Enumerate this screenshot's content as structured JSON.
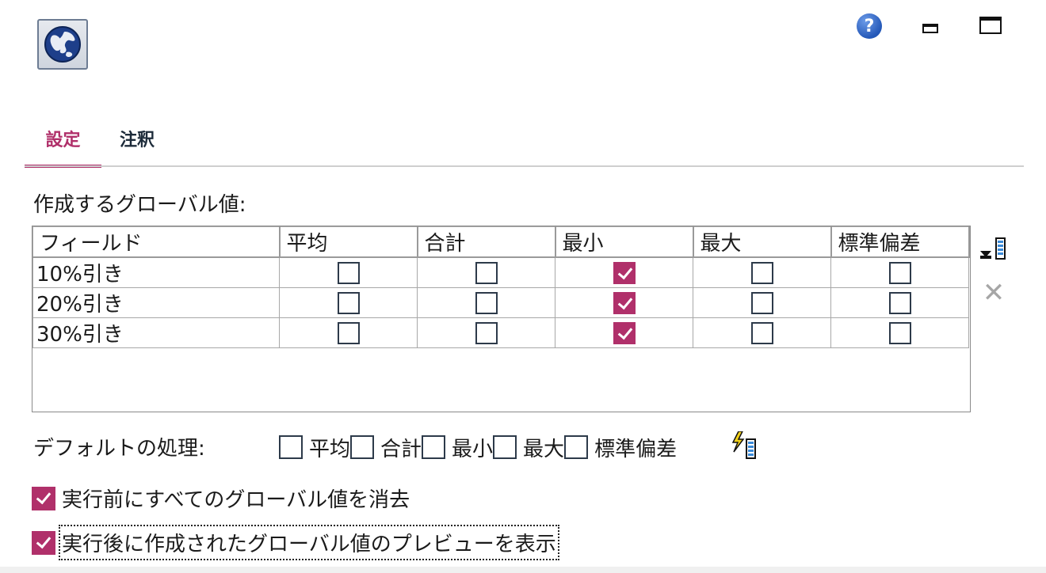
{
  "window": {
    "help_icon": "question-circle",
    "minimize_icon": "window-minimize",
    "maximize_icon": "window-maximize",
    "node_icon": "globe"
  },
  "tabs": [
    {
      "label": "設定",
      "active": true
    },
    {
      "label": "注釈",
      "active": false
    }
  ],
  "globals_label": "作成するグローバル値:",
  "table": {
    "columns": [
      "フィールド",
      "平均",
      "合計",
      "最小",
      "最大",
      "標準偏差"
    ],
    "rows": [
      {
        "field": "10%引き",
        "mean": false,
        "sum": false,
        "min": true,
        "max": false,
        "sdev": false
      },
      {
        "field": "20%引き",
        "mean": false,
        "sum": false,
        "min": true,
        "max": false,
        "sdev": false
      },
      {
        "field": "30%引き",
        "mean": false,
        "sum": false,
        "min": true,
        "max": false,
        "sdev": false
      }
    ]
  },
  "side_buttons": {
    "add_icon": "field-picker",
    "delete_icon": "delete-x"
  },
  "default_label": "デフォルトの処理:",
  "default_options": [
    {
      "label": "平均",
      "checked": false
    },
    {
      "label": "合計",
      "checked": false
    },
    {
      "label": "最小",
      "checked": false
    },
    {
      "label": "最大",
      "checked": false
    },
    {
      "label": "標準偏差",
      "checked": false
    }
  ],
  "default_apply_icon": "apply-defaults",
  "options": [
    {
      "label": "実行前にすべてのグローバル値を消去",
      "checked": true
    },
    {
      "label": "実行後に作成されたグローバル値のプレビューを表示",
      "checked": true
    }
  ],
  "colors": {
    "accent": "#b0306a",
    "tab_inactive": "#1d2b3a",
    "help_blue": "#2458b8"
  }
}
